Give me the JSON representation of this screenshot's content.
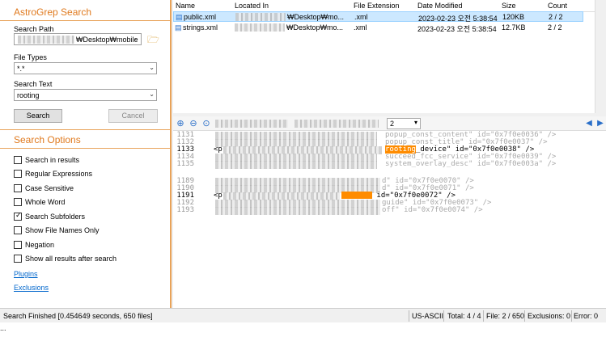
{
  "app": {
    "title": "AstroGrep Search"
  },
  "search": {
    "path_label": "Search Path",
    "path_value": "₩Desktop₩mobile",
    "filetypes_label": "File Types",
    "filetypes_value": "*.*",
    "searchtext_label": "Search Text",
    "searchtext_value": "rooting",
    "search_button": "Search",
    "cancel_button": "Cancel"
  },
  "options": {
    "title": "Search Options",
    "items": [
      {
        "label": "Search in results",
        "checked": false
      },
      {
        "label": "Regular Expressions",
        "checked": false
      },
      {
        "label": "Case Sensitive",
        "checked": false
      },
      {
        "label": "Whole Word",
        "checked": false
      },
      {
        "label": "Search Subfolders",
        "checked": true
      },
      {
        "label": "Show File Names Only",
        "checked": false
      },
      {
        "label": "Negation",
        "checked": false
      },
      {
        "label": "Show all results after search",
        "checked": false
      }
    ],
    "plugins_link": "Plugins",
    "exclusions_link": "Exclusions"
  },
  "results": {
    "headers": {
      "name": "Name",
      "located": "Located In",
      "ext": "File Extension",
      "modified": "Date Modified",
      "size": "Size",
      "count": "Count"
    },
    "rows": [
      {
        "name": "public.xml",
        "located": "₩Desktop₩mo...",
        "ext": ".xml",
        "modified": "2023-02-23 오전 5:38:54",
        "size": "120KB",
        "count": "2 / 2",
        "selected": true
      },
      {
        "name": "strings.xml",
        "located": "₩Desktop₩mo...",
        "ext": ".xml",
        "modified": "2023-02-23 오전 5:38:54",
        "size": "12.7KB",
        "count": "2 / 2",
        "selected": false
      }
    ]
  },
  "viewer": {
    "dropdown_value": "2",
    "lines": [
      {
        "num": "1131",
        "text": "popup_const_content\" id=\"0x7f0e0036\" />",
        "active": false
      },
      {
        "num": "1132",
        "text": "popup_const_title\" id=\"0x7f0e0037\" />",
        "active": false
      },
      {
        "num": "1133",
        "text_pre": "<p",
        "match": "rooting",
        "text_post": "_device\" id=\"0x7f0e0038\" />",
        "active": true
      },
      {
        "num": "1134",
        "text": "succeed_fcc_service\" id=\"0x7f0e0039\" />",
        "active": false
      },
      {
        "num": "1135",
        "text": "system_overlay_desc\" id=\"0x7f0e003a\" />",
        "active": false
      },
      {
        "num": "1189",
        "text": "d\" id=\"0x7f0e0070\" />",
        "active": false
      },
      {
        "num": "1190",
        "text": "d\" id=\"0x7f0e0071\" />",
        "active": false
      },
      {
        "num": "1191",
        "text_pre": "<p",
        "text_post": "id=\"0x7f0e0072\" />",
        "active": true
      },
      {
        "num": "1192",
        "text": "guide\" id=\"0x7f0e0073\" />",
        "active": false
      },
      {
        "num": "1193",
        "text": "off\" id=\"0x7f0e0074\" />",
        "active": false
      }
    ]
  },
  "status": {
    "message": "Search Finished [0.454649 seconds, 650 files]",
    "encoding": "US-ASCII",
    "total": "Total: 4 / 4",
    "file": "File: 2 / 650",
    "exclusions": "Exclusions: 0",
    "error": "Error: 0",
    "extra": "..."
  },
  "colors": {
    "accent": "#e07a1f",
    "selection": "#cce8ff",
    "highlight": "#ff8c00",
    "link": "#0066cc"
  }
}
